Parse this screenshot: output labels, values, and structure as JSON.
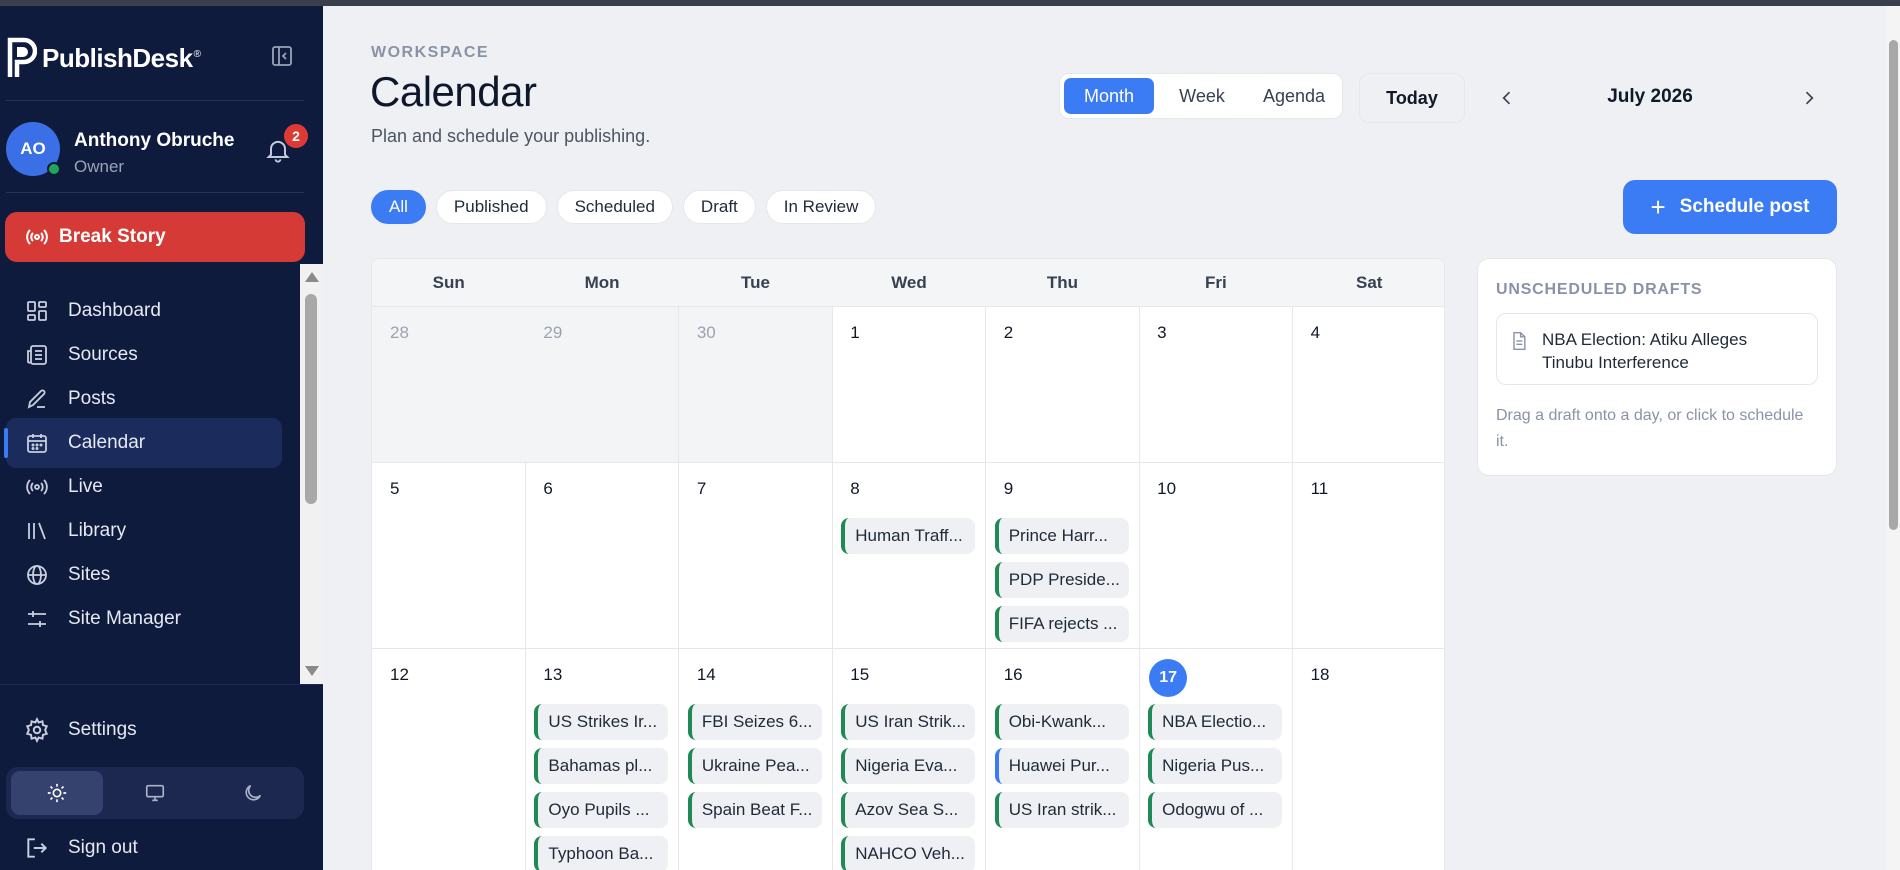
{
  "brand": {
    "name": "PublishDesk",
    "mark": "®"
  },
  "user": {
    "initials": "AO",
    "name": "Anthony Obruche",
    "role": "Owner",
    "notifications": "2"
  },
  "break_story": {
    "label": "Break Story"
  },
  "nav": {
    "items": [
      {
        "id": "dashboard",
        "label": "Dashboard",
        "icon": "dashboard-icon"
      },
      {
        "id": "sources",
        "label": "Sources",
        "icon": "newspaper-icon"
      },
      {
        "id": "posts",
        "label": "Posts",
        "icon": "pen-icon"
      },
      {
        "id": "calendar",
        "label": "Calendar",
        "icon": "calendar-icon",
        "active": true
      },
      {
        "id": "live",
        "label": "Live",
        "icon": "broadcast-icon"
      },
      {
        "id": "library",
        "label": "Library",
        "icon": "library-icon"
      },
      {
        "id": "sites",
        "label": "Sites",
        "icon": "globe-icon"
      },
      {
        "id": "site-manager",
        "label": "Site Manager",
        "icon": "sliders-icon"
      }
    ],
    "settings": "Settings",
    "signout": "Sign out"
  },
  "header": {
    "eyebrow": "WORKSPACE",
    "title": "Calendar",
    "subtitle": "Plan and schedule your publishing.",
    "views": [
      "Month",
      "Week",
      "Agenda"
    ],
    "active_view": "Month",
    "today": "Today",
    "month": "July 2026"
  },
  "filters": [
    "All",
    "Published",
    "Scheduled",
    "Draft",
    "In Review"
  ],
  "schedule_button": "Schedule post",
  "calendar": {
    "weekdays": [
      "Sun",
      "Mon",
      "Tue",
      "Wed",
      "Thu",
      "Fri",
      "Sat"
    ],
    "weeks": [
      [
        {
          "day": "28",
          "muted": true,
          "posts": []
        },
        {
          "day": "29",
          "muted": true,
          "posts": []
        },
        {
          "day": "30",
          "muted": true,
          "posts": []
        },
        {
          "day": "1",
          "posts": []
        },
        {
          "day": "2",
          "posts": []
        },
        {
          "day": "3",
          "posts": []
        },
        {
          "day": "4",
          "posts": []
        }
      ],
      [
        {
          "day": "5",
          "posts": []
        },
        {
          "day": "6",
          "posts": []
        },
        {
          "day": "7",
          "posts": []
        },
        {
          "day": "8",
          "posts": [
            {
              "title": "Human Traff...",
              "status": "published"
            }
          ]
        },
        {
          "day": "9",
          "posts": [
            {
              "title": "Prince Harr...",
              "status": "published"
            },
            {
              "title": "PDP Preside...",
              "status": "published"
            },
            {
              "title": "FIFA rejects ...",
              "status": "published"
            }
          ]
        },
        {
          "day": "10",
          "posts": []
        },
        {
          "day": "11",
          "posts": []
        }
      ],
      [
        {
          "day": "12",
          "posts": []
        },
        {
          "day": "13",
          "posts": [
            {
              "title": "US Strikes Ir...",
              "status": "published"
            },
            {
              "title": "Bahamas pl...",
              "status": "published"
            },
            {
              "title": "Oyo Pupils ...",
              "status": "published"
            },
            {
              "title": "Typhoon Ba...",
              "status": "published"
            }
          ]
        },
        {
          "day": "14",
          "posts": [
            {
              "title": "FBI Seizes 6...",
              "status": "published"
            },
            {
              "title": "Ukraine Pea...",
              "status": "published"
            },
            {
              "title": "Spain Beat F...",
              "status": "published"
            }
          ]
        },
        {
          "day": "15",
          "posts": [
            {
              "title": "US Iran Strik...",
              "status": "published"
            },
            {
              "title": "Nigeria Eva...",
              "status": "published"
            },
            {
              "title": "Azov Sea S...",
              "status": "published"
            },
            {
              "title": "NAHCO Veh...",
              "status": "published"
            }
          ]
        },
        {
          "day": "16",
          "posts": [
            {
              "title": "Obi-Kwank...",
              "status": "published"
            },
            {
              "title": "Huawei Pur...",
              "status": "scheduled"
            },
            {
              "title": "US Iran strik...",
              "status": "published"
            }
          ]
        },
        {
          "day": "17",
          "today": true,
          "posts": [
            {
              "title": "NBA Electio...",
              "status": "published"
            },
            {
              "title": "Nigeria Pus...",
              "status": "published"
            },
            {
              "title": "Odogwu of ...",
              "status": "published"
            }
          ]
        },
        {
          "day": "18",
          "posts": []
        }
      ]
    ]
  },
  "drafts": {
    "title": "UNSCHEDULED DRAFTS",
    "items": [
      "NBA Election: Atiku Alleges Tinubu Interference"
    ],
    "hint": "Drag a draft onto a day, or click to schedule it."
  },
  "colors": {
    "accent": "#3b7cf4",
    "sidebar": "#0f1b3d",
    "danger": "#d63a36",
    "published": "#1f8a55"
  }
}
